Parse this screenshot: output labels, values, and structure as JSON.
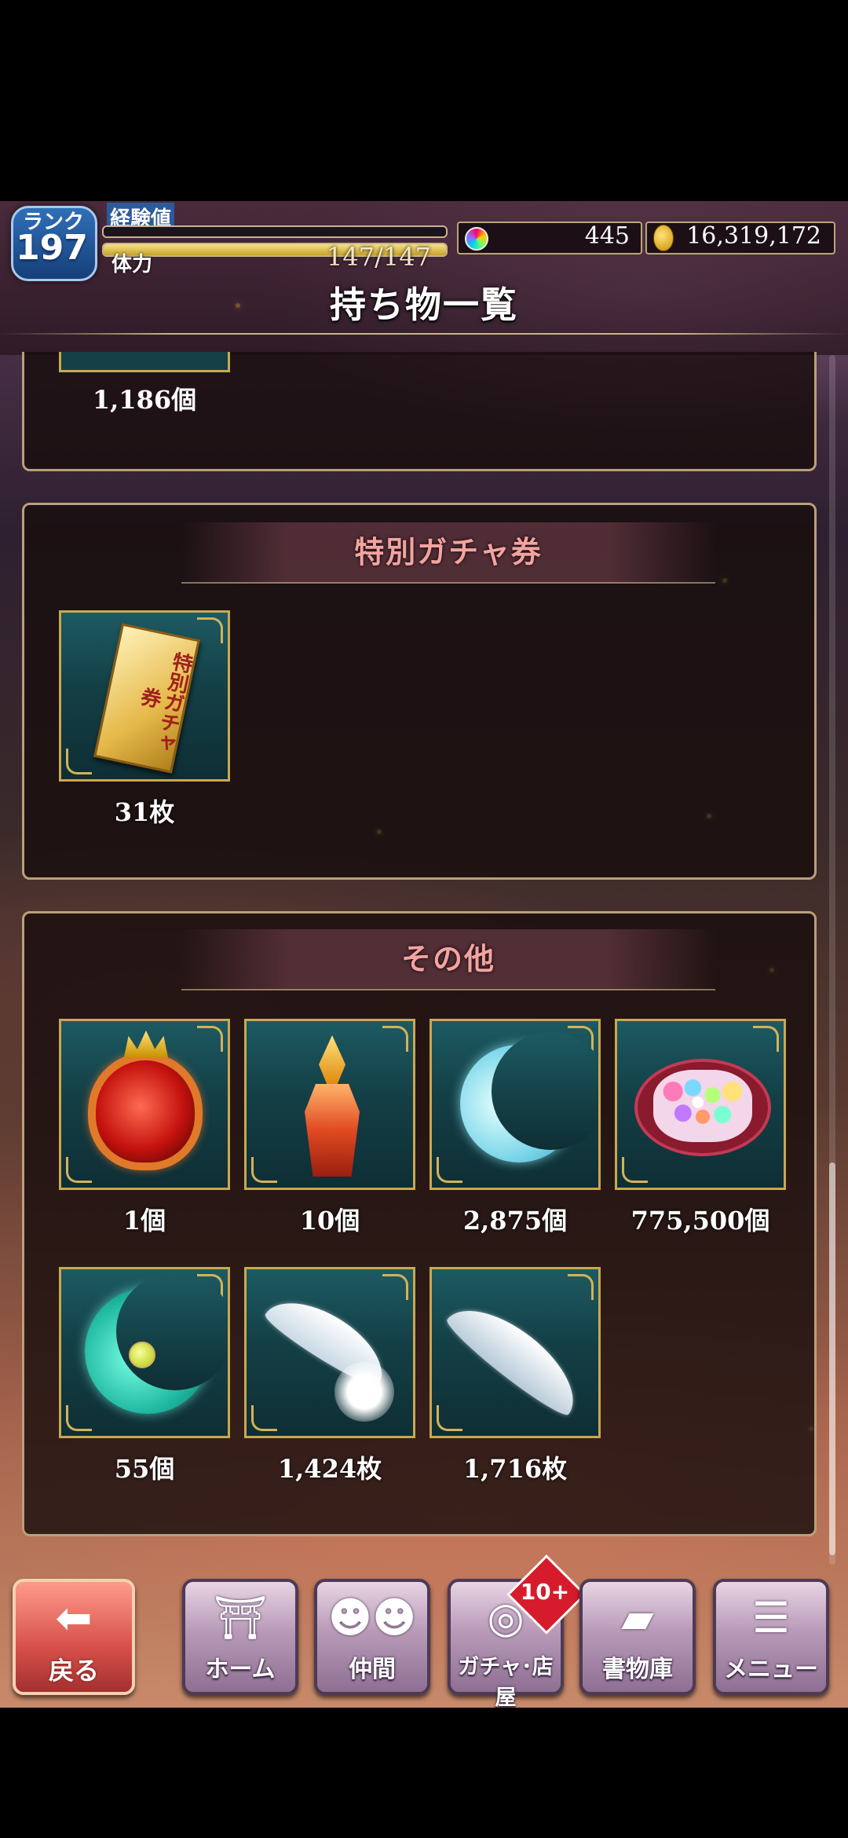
{
  "hud": {
    "rank_label": "ランク",
    "rank_value": "197",
    "exp_label": "経験値",
    "stamina_label": "体力",
    "stamina_value": "147/147",
    "stamina_fraction": 1.0,
    "exp_fraction": 0.0,
    "gems": "445",
    "coins": "16,319,172"
  },
  "page_title": "持ち物一覧",
  "sections": {
    "top": {
      "items": [
        {
          "count": "1,186個"
        }
      ]
    },
    "special_gacha": {
      "title": "特別ガチャ券",
      "items": [
        {
          "icon": "gacha-ticket-icon",
          "ticket_text": "特別ガチャ券",
          "count": "31枚"
        }
      ]
    },
    "other": {
      "title": "その他",
      "items": [
        {
          "icon": "red-potion-icon",
          "count": "1個"
        },
        {
          "icon": "elixir-bottle-icon",
          "count": "10個"
        },
        {
          "icon": "crescent-moon-icon",
          "count": "2,875個"
        },
        {
          "icon": "konpeito-candy-icon",
          "count": "775,500個"
        },
        {
          "icon": "moon-charm-icon",
          "count": "55個"
        },
        {
          "icon": "fluffy-feather-icon",
          "count": "1,424枚"
        },
        {
          "icon": "white-feather-icon",
          "count": "1,716枚"
        }
      ]
    }
  },
  "nav": {
    "back": "戻る",
    "home": "ホーム",
    "friends": "仲間",
    "gacha_shop": "ガチャ･店屋",
    "gacha_badge": "10+",
    "library": "書物庫",
    "menu": "メニュー"
  },
  "colors": {
    "panel_title": "#f4a3a0",
    "frame_gold": "#c9a850",
    "item_bg": "#1d5a62"
  }
}
